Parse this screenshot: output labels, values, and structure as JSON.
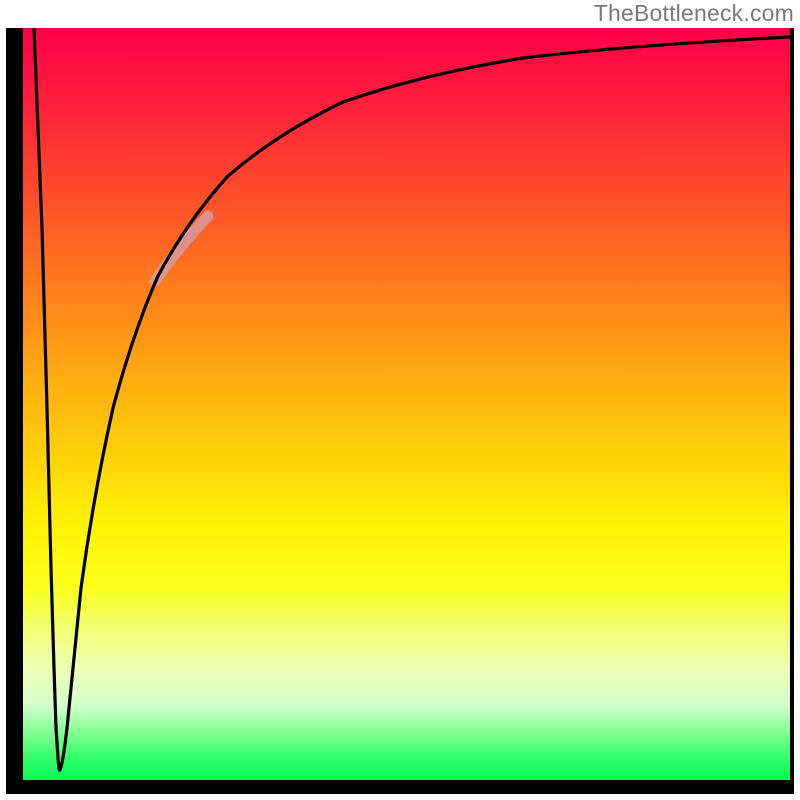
{
  "watermark": "TheBottleneck.com",
  "colors": {
    "frame": "#000000",
    "curve": "#000000",
    "highlight": "#d59aa0",
    "gradient_top": "#ff0048",
    "gradient_bottom": "#08f85a"
  },
  "chart_data": {
    "type": "line",
    "title": "",
    "xlabel": "",
    "ylabel": "",
    "xlim": [
      0,
      100
    ],
    "ylim": [
      0,
      100
    ],
    "grid": false,
    "legend": false,
    "background": "vertical-gradient red→yellow→green",
    "annotations": [
      "TheBottleneck.com"
    ],
    "series": [
      {
        "name": "bottleneck-curve",
        "x": [
          1.4,
          2.5,
          3.1,
          3.7,
          4.0,
          4.3,
          4.6,
          4.8,
          5.2,
          5.7,
          7.6,
          9.1,
          11.7,
          14.3,
          17.6,
          21.5,
          26.7,
          33.2,
          41.7,
          52.2,
          65.2,
          79.5,
          100.0
        ],
        "values": [
          100,
          73.4,
          49.5,
          28.2,
          14.9,
          6.9,
          2.9,
          1.3,
          2.3,
          6.9,
          25.5,
          34.5,
          49.5,
          59.4,
          67,
          74.5,
          80.3,
          86,
          90.2,
          93.9,
          96,
          97.7,
          98.8
        ]
      },
      {
        "name": "highlight-segment",
        "x": [
          17.2,
          20.5,
          24.1
        ],
        "values": [
          66.4,
          70.8,
          75.0
        ]
      }
    ]
  }
}
